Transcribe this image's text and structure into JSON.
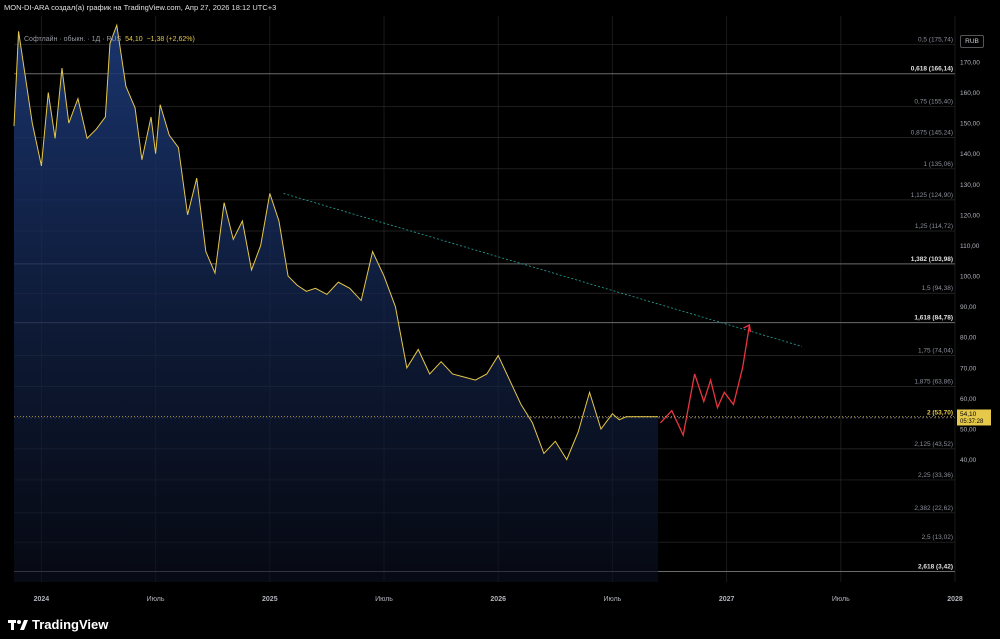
{
  "header": {
    "text": "MON-DI-ARA создал(а) график на TradingView.com, Апр 27, 2026 18:12 UTC+3"
  },
  "legend": {
    "symbol": "Софтлайн · обыкн. · 1Д · RUS",
    "price": "54,10",
    "change": "−1,38 (+2,62%)"
  },
  "currency_button": "RUB",
  "logo_text": "TradingView",
  "colors": {
    "price_line": "#e6c84a",
    "projection": "#e8343f",
    "trendline": "#26a69a",
    "fill_top": "#1c3a7a"
  },
  "price_tag": {
    "value": "54,10",
    "timer": "05:37:28"
  },
  "chart_data": {
    "type": "line",
    "ylim": [
      0,
      185
    ],
    "y_ticks": [
      40,
      50,
      60,
      70,
      80,
      90,
      100,
      110,
      120,
      130,
      140,
      150,
      160,
      170
    ],
    "y_tick_labels": [
      "40,00",
      "50,00",
      "60,00",
      "70,00",
      "80,00",
      "90,00",
      "100,00",
      "110,00",
      "120,00",
      "130,00",
      "140,00",
      "150,00",
      "160,00",
      "170,00"
    ],
    "x_ticks": [
      {
        "label": "2024",
        "t": 2024.0
      },
      {
        "label": "Июль",
        "t": 2024.5
      },
      {
        "label": "2025",
        "t": 2025.0
      },
      {
        "label": "Июль",
        "t": 2025.5
      },
      {
        "label": "2026",
        "t": 2026.0
      },
      {
        "label": "Июль",
        "t": 2026.5
      },
      {
        "label": "2027",
        "t": 2027.0
      },
      {
        "label": "Июль",
        "t": 2027.5
      },
      {
        "label": "2028",
        "t": 2028.0
      }
    ],
    "xlim": [
      2023.88,
      2028.0
    ],
    "price_series": {
      "x": [
        2023.88,
        2023.9,
        2023.93,
        2023.96,
        2024.0,
        2024.03,
        2024.06,
        2024.09,
        2024.12,
        2024.16,
        2024.2,
        2024.24,
        2024.28,
        2024.3,
        2024.33,
        2024.37,
        2024.41,
        2024.44,
        2024.48,
        2024.5,
        2024.52,
        2024.56,
        2024.6,
        2024.64,
        2024.68,
        2024.72,
        2024.76,
        2024.8,
        2024.84,
        2024.88,
        2024.92,
        2024.96,
        2025.0,
        2025.04,
        2025.08,
        2025.12,
        2025.16,
        2025.2,
        2025.25,
        2025.3,
        2025.35,
        2025.4,
        2025.45,
        2025.5,
        2025.55,
        2025.6,
        2025.65,
        2025.7,
        2025.75,
        2025.8,
        2025.85,
        2025.9,
        2025.95,
        2026.0,
        2026.05,
        2026.1,
        2026.15,
        2026.2,
        2026.25,
        2026.3,
        2026.35,
        2026.4,
        2026.45,
        2026.5,
        2026.53,
        2026.56,
        2026.59,
        2026.62,
        2026.65,
        2026.7
      ],
      "y": [
        149,
        180,
        165,
        150,
        136,
        160,
        145,
        168,
        150,
        158,
        145,
        148,
        152,
        176,
        182,
        162,
        155,
        138,
        152,
        140,
        156,
        146,
        142,
        120,
        132,
        108,
        101,
        124,
        112,
        118,
        102,
        110,
        127,
        118,
        100,
        97,
        95,
        96,
        94,
        98,
        96,
        92,
        108,
        100,
        90,
        70,
        76,
        68,
        72,
        68,
        67,
        66,
        68,
        74,
        66,
        58,
        52,
        42,
        46,
        40,
        49,
        62,
        50,
        55,
        53,
        54,
        54,
        54,
        54,
        54
      ]
    },
    "projection_series": {
      "x": [
        2026.71,
        2026.76,
        2026.81,
        2026.86,
        2026.9,
        2026.93,
        2026.96,
        2026.99,
        2027.03,
        2027.07,
        2027.1
      ],
      "y": [
        52,
        56,
        48,
        68,
        59,
        66,
        57,
        62,
        58,
        70,
        84
      ]
    },
    "trendline": {
      "x": [
        2025.06,
        2027.33
      ],
      "y": [
        127,
        77
      ]
    },
    "fib_levels": [
      {
        "label": "0,5 (175,74)",
        "value": 175.74,
        "bold": false
      },
      {
        "label": "0,618 (166,14)",
        "value": 166.14,
        "bold": true
      },
      {
        "label": "0,75 (155,40)",
        "value": 155.4,
        "bold": false
      },
      {
        "label": "0,875 (145,24)",
        "value": 145.24,
        "bold": false
      },
      {
        "label": "1 (135,06)",
        "value": 135.06,
        "bold": false
      },
      {
        "label": "1,125 (124,90)",
        "value": 124.9,
        "bold": false
      },
      {
        "label": "1,25 (114,72)",
        "value": 114.72,
        "bold": false
      },
      {
        "label": "1,382 (103,98)",
        "value": 103.98,
        "bold": true
      },
      {
        "label": "1,5 (94,38)",
        "value": 94.38,
        "bold": false
      },
      {
        "label": "1,618 (84,78)",
        "value": 84.78,
        "bold": true
      },
      {
        "label": "1,75 (74,04)",
        "value": 74.04,
        "bold": false
      },
      {
        "label": "1,875 (63,86)",
        "value": 63.86,
        "bold": false
      },
      {
        "label": "2 (53,70)",
        "value": 53.7,
        "bold": true
      },
      {
        "label": "2,125 (43,52)",
        "value": 43.52,
        "bold": false
      },
      {
        "label": "2,25 (33,36)",
        "value": 33.36,
        "bold": false
      },
      {
        "label": "2,382 (22,62)",
        "value": 22.62,
        "bold": false
      },
      {
        "label": "2,5 (13,02)",
        "value": 13.02,
        "bold": false
      },
      {
        "label": "2,618 (3,42)",
        "value": 3.42,
        "bold": true
      }
    ]
  }
}
